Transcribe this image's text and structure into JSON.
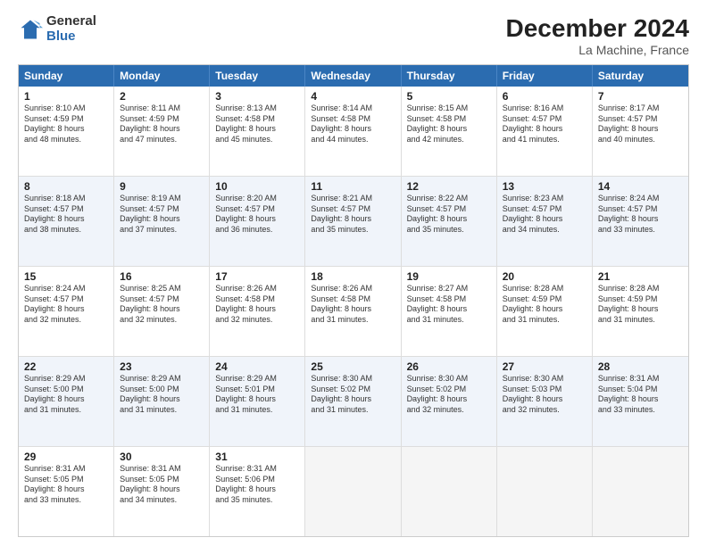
{
  "logo": {
    "general": "General",
    "blue": "Blue"
  },
  "title": "December 2024",
  "location": "La Machine, France",
  "header_days": [
    "Sunday",
    "Monday",
    "Tuesday",
    "Wednesday",
    "Thursday",
    "Friday",
    "Saturday"
  ],
  "weeks": [
    [
      {
        "day": "1",
        "text": "Sunrise: 8:10 AM\nSunset: 4:59 PM\nDaylight: 8 hours\nand 48 minutes."
      },
      {
        "day": "2",
        "text": "Sunrise: 8:11 AM\nSunset: 4:59 PM\nDaylight: 8 hours\nand 47 minutes."
      },
      {
        "day": "3",
        "text": "Sunrise: 8:13 AM\nSunset: 4:58 PM\nDaylight: 8 hours\nand 45 minutes."
      },
      {
        "day": "4",
        "text": "Sunrise: 8:14 AM\nSunset: 4:58 PM\nDaylight: 8 hours\nand 44 minutes."
      },
      {
        "day": "5",
        "text": "Sunrise: 8:15 AM\nSunset: 4:58 PM\nDaylight: 8 hours\nand 42 minutes."
      },
      {
        "day": "6",
        "text": "Sunrise: 8:16 AM\nSunset: 4:57 PM\nDaylight: 8 hours\nand 41 minutes."
      },
      {
        "day": "7",
        "text": "Sunrise: 8:17 AM\nSunset: 4:57 PM\nDaylight: 8 hours\nand 40 minutes."
      }
    ],
    [
      {
        "day": "8",
        "text": "Sunrise: 8:18 AM\nSunset: 4:57 PM\nDaylight: 8 hours\nand 38 minutes."
      },
      {
        "day": "9",
        "text": "Sunrise: 8:19 AM\nSunset: 4:57 PM\nDaylight: 8 hours\nand 37 minutes."
      },
      {
        "day": "10",
        "text": "Sunrise: 8:20 AM\nSunset: 4:57 PM\nDaylight: 8 hours\nand 36 minutes."
      },
      {
        "day": "11",
        "text": "Sunrise: 8:21 AM\nSunset: 4:57 PM\nDaylight: 8 hours\nand 35 minutes."
      },
      {
        "day": "12",
        "text": "Sunrise: 8:22 AM\nSunset: 4:57 PM\nDaylight: 8 hours\nand 35 minutes."
      },
      {
        "day": "13",
        "text": "Sunrise: 8:23 AM\nSunset: 4:57 PM\nDaylight: 8 hours\nand 34 minutes."
      },
      {
        "day": "14",
        "text": "Sunrise: 8:24 AM\nSunset: 4:57 PM\nDaylight: 8 hours\nand 33 minutes."
      }
    ],
    [
      {
        "day": "15",
        "text": "Sunrise: 8:24 AM\nSunset: 4:57 PM\nDaylight: 8 hours\nand 32 minutes."
      },
      {
        "day": "16",
        "text": "Sunrise: 8:25 AM\nSunset: 4:57 PM\nDaylight: 8 hours\nand 32 minutes."
      },
      {
        "day": "17",
        "text": "Sunrise: 8:26 AM\nSunset: 4:58 PM\nDaylight: 8 hours\nand 32 minutes."
      },
      {
        "day": "18",
        "text": "Sunrise: 8:26 AM\nSunset: 4:58 PM\nDaylight: 8 hours\nand 31 minutes."
      },
      {
        "day": "19",
        "text": "Sunrise: 8:27 AM\nSunset: 4:58 PM\nDaylight: 8 hours\nand 31 minutes."
      },
      {
        "day": "20",
        "text": "Sunrise: 8:28 AM\nSunset: 4:59 PM\nDaylight: 8 hours\nand 31 minutes."
      },
      {
        "day": "21",
        "text": "Sunrise: 8:28 AM\nSunset: 4:59 PM\nDaylight: 8 hours\nand 31 minutes."
      }
    ],
    [
      {
        "day": "22",
        "text": "Sunrise: 8:29 AM\nSunset: 5:00 PM\nDaylight: 8 hours\nand 31 minutes."
      },
      {
        "day": "23",
        "text": "Sunrise: 8:29 AM\nSunset: 5:00 PM\nDaylight: 8 hours\nand 31 minutes."
      },
      {
        "day": "24",
        "text": "Sunrise: 8:29 AM\nSunset: 5:01 PM\nDaylight: 8 hours\nand 31 minutes."
      },
      {
        "day": "25",
        "text": "Sunrise: 8:30 AM\nSunset: 5:02 PM\nDaylight: 8 hours\nand 31 minutes."
      },
      {
        "day": "26",
        "text": "Sunrise: 8:30 AM\nSunset: 5:02 PM\nDaylight: 8 hours\nand 32 minutes."
      },
      {
        "day": "27",
        "text": "Sunrise: 8:30 AM\nSunset: 5:03 PM\nDaylight: 8 hours\nand 32 minutes."
      },
      {
        "day": "28",
        "text": "Sunrise: 8:31 AM\nSunset: 5:04 PM\nDaylight: 8 hours\nand 33 minutes."
      }
    ],
    [
      {
        "day": "29",
        "text": "Sunrise: 8:31 AM\nSunset: 5:05 PM\nDaylight: 8 hours\nand 33 minutes."
      },
      {
        "day": "30",
        "text": "Sunrise: 8:31 AM\nSunset: 5:05 PM\nDaylight: 8 hours\nand 34 minutes."
      },
      {
        "day": "31",
        "text": "Sunrise: 8:31 AM\nSunset: 5:06 PM\nDaylight: 8 hours\nand 35 minutes."
      },
      {
        "day": "",
        "text": ""
      },
      {
        "day": "",
        "text": ""
      },
      {
        "day": "",
        "text": ""
      },
      {
        "day": "",
        "text": ""
      }
    ]
  ]
}
